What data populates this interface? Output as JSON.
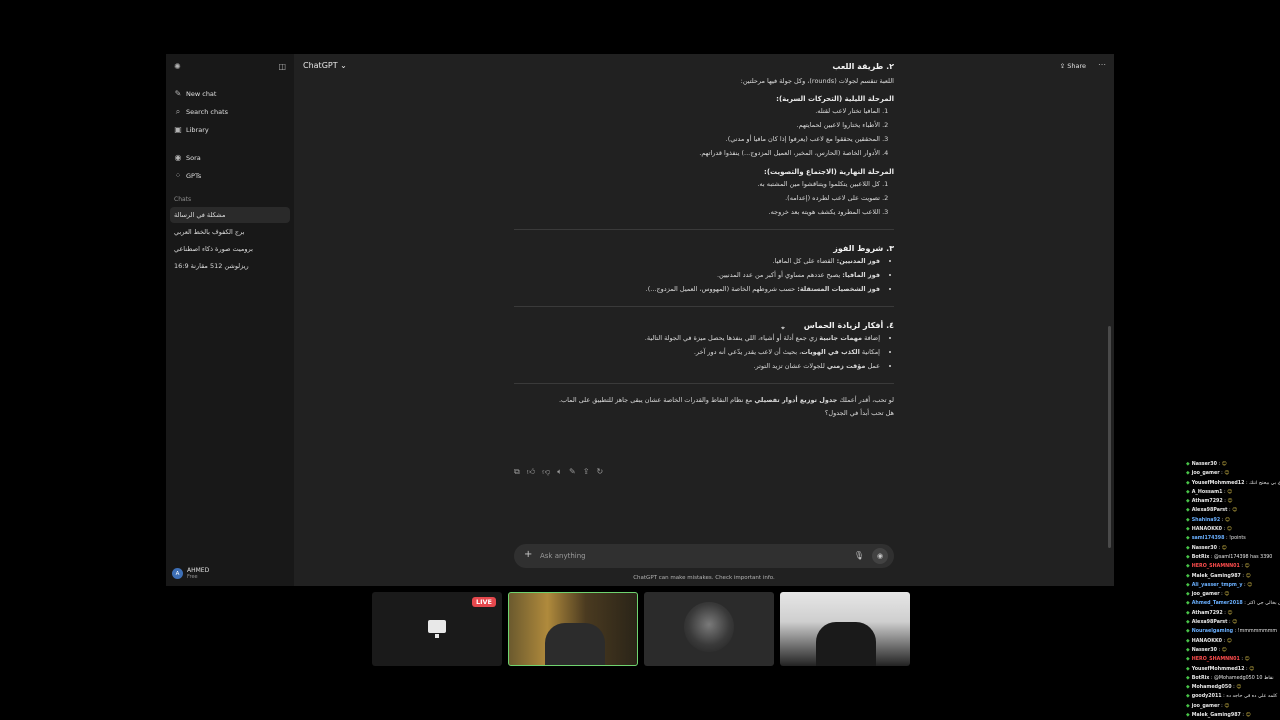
{
  "sidebar": {
    "logo_icon": "openai-logo-icon",
    "toggle_icon": "sidebar-toggle-icon",
    "items": [
      {
        "label": "New chat",
        "icon": "new-chat-icon"
      },
      {
        "label": "Search chats",
        "icon": "search-icon"
      },
      {
        "label": "Library",
        "icon": "library-icon"
      }
    ],
    "items2": [
      {
        "label": "Sora",
        "icon": "sora-icon"
      },
      {
        "label": "GPTs",
        "icon": "gpts-icon"
      }
    ],
    "chats_heading": "Chats",
    "chats": [
      "مشكلة في الرسالة",
      "برج الكفوف بالخط العربي",
      "بروميت صورة ذكاء اصطناعي",
      "ريزلوشن 512 مقارنة 16:9"
    ],
    "user": {
      "initial": "A",
      "name": "AHMED",
      "plan": "Free"
    }
  },
  "header": {
    "model": "ChatGPT ⌄",
    "share": "Share",
    "more": "⋯"
  },
  "content": {
    "section2_title": "٢. طريقة اللعب",
    "section2_intro": "اللعبة تنقسم لجولات (rounds)، وكل جولة فيها مرحلتين:",
    "night_title": "المرحلة الليلية (التحركات السرية):",
    "night_items": [
      "المافيا تختار لاعب لقتله.",
      "الأطباء يختاروا لاعبين لحمايتهم.",
      "المحققين يحققوا مع لاعب (يعرفوا إذا كان مافيا أو مدني).",
      "الأدوار الخاصة (الحارس، المخبر، العميل المزدوج...) ينفذوا قدراتهم."
    ],
    "day_title": "المرحلة النهارية (الاجتماع والتصويت):",
    "day_items": [
      "كل اللاعبين يتكلموا ويتناقشوا مين المشتبه به.",
      "تصويت على لاعب لطرده (إعدامه).",
      "اللاعب المطرود يكشف هويته بعد خروجه."
    ],
    "section3_title": "٣. شروط الفوز",
    "win_items": [
      {
        "bold": "فوز المدنيين:",
        "text": " القضاء على كل المافيا."
      },
      {
        "bold": "فوز المافيا:",
        "text": " يصبح عددهم مساوي أو أكبر من عدد المدنيين."
      },
      {
        "bold": "فوز الشخصيات المستقلة:",
        "text": " حسب شروطهم الخاصة (المهووس، العميل المزدوج...)."
      }
    ],
    "section4_title": "٤. أفكار لزيادة الحماس",
    "ideas": [
      {
        "pre": "إضافة ",
        "bold": "مهمات جانبية",
        "post": " زي جمع أدلة أو أشياء، اللي ينفذها يحصل ميزة في الجولة التالية."
      },
      {
        "pre": "إمكانية ",
        "bold": "الكذب في الهويات",
        "post": "، بحيث أن لاعب يقدر يدّعي أنه دور آخر."
      },
      {
        "pre": "عمل ",
        "bold": "مؤقت زمني",
        "post": " للجولات عشان تزيد التوتر."
      }
    ],
    "closing_pre": "لو تحب، أقدر أعملك ",
    "closing_bold": "جدول توزيع أدوار تفصيلي",
    "closing_post": " مع نظام النقاط والقدرات الخاصة عشان يبقى جاهز للتطبيق على الماب.",
    "closing_question": "هل تحب أبدأ في الجدول؟"
  },
  "actions": [
    "copy-icon",
    "thumbs-up-icon",
    "thumbs-down-icon",
    "speaker-icon",
    "edit-icon",
    "share-icon",
    "regenerate-icon"
  ],
  "composer": {
    "placeholder": "Ask anything",
    "plus": "+",
    "mic": "🎙",
    "voice": "◉"
  },
  "disclaimer": "ChatGPT can make mistakes. Check important info.",
  "stream": {
    "live_label": "LIVE"
  },
  "stream_chat": [
    {
      "user": "Nasser30",
      "text": "",
      "color": "#e8e8e8",
      "emote": "☺"
    },
    {
      "user": "joo_gamer",
      "text": "",
      "color": "#e8e8e8",
      "emote": "☺"
    },
    {
      "user": "YousefMohmmed12",
      "text": "ي بي بيحتج انتك",
      "color": "#e8e8e8",
      "emote": ""
    },
    {
      "user": "A_Hossam1",
      "text": "",
      "color": "#e8e8e8",
      "emote": "☺"
    },
    {
      "user": "Atham7292",
      "text": "",
      "color": "#e8e8e8",
      "emote": "☺"
    },
    {
      "user": "Alexa98Parst",
      "text": "",
      "color": "#e8e8e8",
      "emote": "☺"
    },
    {
      "user": "Shahina92",
      "text": "",
      "color": "#6ab0ff",
      "emote": "☺"
    },
    {
      "user": "HANAOKK0",
      "text": "",
      "color": "#e8e8e8",
      "emote": "☺"
    },
    {
      "user": "saml174398",
      "text": "!points",
      "color": "#6ab0ff",
      "emote": ""
    },
    {
      "user": "Nasser30",
      "text": "",
      "color": "#e8e8e8",
      "emote": "☺"
    },
    {
      "user": "BotRix",
      "text": "@saml174398 has 3390",
      "color": "#e8e8e8",
      "emote": ""
    },
    {
      "user": "HERO_SHAMNN01",
      "text": "",
      "color": "#ff4d4d",
      "emote": "☺"
    },
    {
      "user": "Malek_Gaming987",
      "text": "",
      "color": "#e8e8e8",
      "emote": "☺"
    },
    {
      "user": "Ali_yasser_tmpm_y",
      "text": "",
      "color": "#6ab0ff",
      "emote": "☺"
    },
    {
      "user": "joo_gamer",
      "text": "",
      "color": "#e8e8e8",
      "emote": "☺"
    },
    {
      "user": "Ahmed_Tamer2018",
      "text": "بان بخالي جي اكتر",
      "color": "#6ab0ff",
      "emote": ""
    },
    {
      "user": "Atham7292",
      "text": "",
      "color": "#e8e8e8",
      "emote": "☺"
    },
    {
      "user": "Alexa98Parst",
      "text": "",
      "color": "#e8e8e8",
      "emote": "☺"
    },
    {
      "user": "Nouraelgaming",
      "text": "!mmmmmmmm",
      "color": "#6ab0ff",
      "emote": ""
    },
    {
      "user": "HANAOKK0",
      "text": "",
      "color": "#e8e8e8",
      "emote": "☺"
    },
    {
      "user": "Nasser30",
      "text": "",
      "color": "#e8e8e8",
      "emote": "☺"
    },
    {
      "user": "HERO_SHAMNN01",
      "text": "",
      "color": "#ff4d4d",
      "emote": "☺"
    },
    {
      "user": "YousefMohmmed12",
      "text": "",
      "color": "#e8e8e8",
      "emote": "☺"
    },
    {
      "user": "BotRix",
      "text": "@Mohamedg050 10 نقاط",
      "color": "#e8e8e8",
      "emote": ""
    },
    {
      "user": "Mohamedg050",
      "text": "",
      "color": "#e8e8e8",
      "emote": "☺"
    },
    {
      "user": "goody2011",
      "text": "كلمه علي ده في حاجه ده",
      "color": "#e8e8e8",
      "emote": ""
    },
    {
      "user": "joo_gamer",
      "text": "",
      "color": "#e8e8e8",
      "emote": "☺"
    },
    {
      "user": "Malek_Gaming987",
      "text": "",
      "color": "#e8e8e8",
      "emote": "☺"
    }
  ]
}
